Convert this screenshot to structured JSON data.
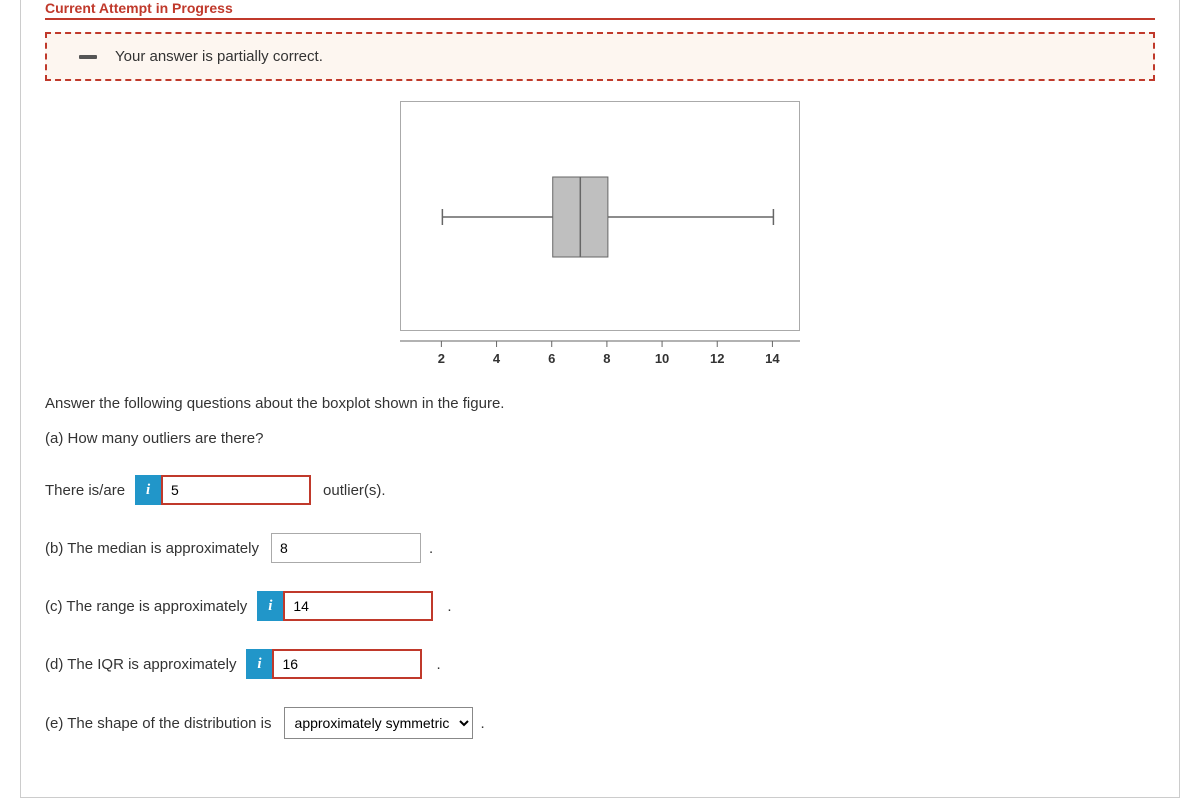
{
  "section_title": "Current Attempt in Progress",
  "feedback": "Your answer is partially correct.",
  "chart_data": {
    "type": "boxplot",
    "x_ticks": [
      2,
      4,
      6,
      8,
      10,
      12,
      14
    ],
    "xlim": [
      0.5,
      15
    ],
    "whisker_low": 2,
    "q1": 6,
    "median": 7,
    "q3": 8,
    "whisker_high": 14,
    "outliers": []
  },
  "intro": "Answer the following questions about the boxplot shown in the figure.",
  "a": {
    "prompt": "(a) How many outliers are there?",
    "lead": "There is/are",
    "value": "5",
    "trail": "outlier(s)."
  },
  "b": {
    "label": "(b) The median is approximately",
    "value": "8"
  },
  "c": {
    "label": "(c) The range is approximately",
    "value": "14"
  },
  "d": {
    "label": "(d) The IQR is approximately",
    "value": "16"
  },
  "e": {
    "label": "(e) The shape of the distribution is",
    "selected": "approximately symmetric"
  },
  "info_glyph": "i"
}
